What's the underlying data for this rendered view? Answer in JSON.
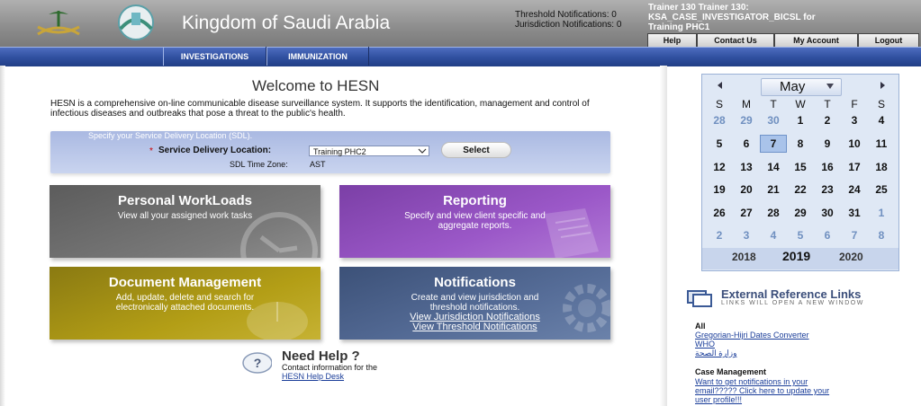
{
  "header": {
    "title": "Kingdom of Saudi Arabia",
    "threshold_notifications": "Threshold Notifications: 0",
    "jurisdiction_notifications": "Jurisdiction Notifications: 0",
    "user_line1": "Trainer 130 Trainer 130:",
    "user_line2": "KSA_CASE_INVESTIGATOR_BICSL for",
    "user_line3": "Training PHC1",
    "links": [
      "Help",
      "Contact Us",
      "My Account",
      "Logout"
    ]
  },
  "nav": {
    "tabs": [
      "INVESTIGATIONS",
      "IMMUNIZATION"
    ]
  },
  "main": {
    "welcome": "Welcome to HESN",
    "intro": "HESN is a comprehensive on-line communicable disease surveillance system. It supports the identification, management and control of infectious diseases and outbreaks that pose a threat to the public's health."
  },
  "sdl": {
    "heading": "Specify your Service Delivery Location (SDL).",
    "required_mark": "*",
    "label": "Service Delivery Location:",
    "selected": "Training PHC2",
    "select_button": "Select",
    "tz_label": "SDL Time Zone:",
    "tz_value": "AST"
  },
  "tiles": {
    "personal": {
      "title": "Personal WorkLoads",
      "desc": "View all your assigned work tasks"
    },
    "reporting": {
      "title": "Reporting",
      "desc1": "Specify and view client specific and",
      "desc2": "aggregate reports."
    },
    "document": {
      "title": "Document Management",
      "desc1": "Add, update, delete and search for",
      "desc2": "electronically attached documents."
    },
    "notifications": {
      "title": "Notifications",
      "desc1": "Create and view jurisdiction and",
      "desc2": "threshold notifications.",
      "link1": "View Jurisdiction Notifications",
      "link2": "View Threshold Notifications"
    }
  },
  "help": {
    "title": "Need Help ?",
    "subtitle": "Contact information for the",
    "link": "HESN Help Desk"
  },
  "calendar": {
    "prev": "◄",
    "next": "►",
    "month": "May",
    "dow": [
      "S",
      "M",
      "T",
      "W",
      "T",
      "F",
      "S"
    ],
    "weeks": [
      [
        "28",
        "29",
        "30",
        "1",
        "2",
        "3",
        "4"
      ],
      [
        "5",
        "6",
        "7",
        "8",
        "9",
        "10",
        "11"
      ],
      [
        "12",
        "13",
        "14",
        "15",
        "16",
        "17",
        "18"
      ],
      [
        "19",
        "20",
        "21",
        "22",
        "23",
        "24",
        "25"
      ],
      [
        "26",
        "27",
        "28",
        "29",
        "30",
        "31",
        "1"
      ],
      [
        "2",
        "3",
        "4",
        "5",
        "6",
        "7",
        "8"
      ]
    ],
    "selected_day": "7",
    "years": [
      "2018",
      "2019",
      "2020"
    ]
  },
  "external": {
    "title": "External Reference Links",
    "subtitle": "LINKS WILL OPEN A NEW WINDOW",
    "all_label": "All",
    "all_links": [
      "Gregorian-Hijri Dates Converter",
      "WHO",
      "وزارة الصحة"
    ],
    "cm_label": "Case Management",
    "cm_link_lines": [
      "Want to get notifications in your",
      "email????? Click here to update your",
      "user profile!!!"
    ]
  }
}
